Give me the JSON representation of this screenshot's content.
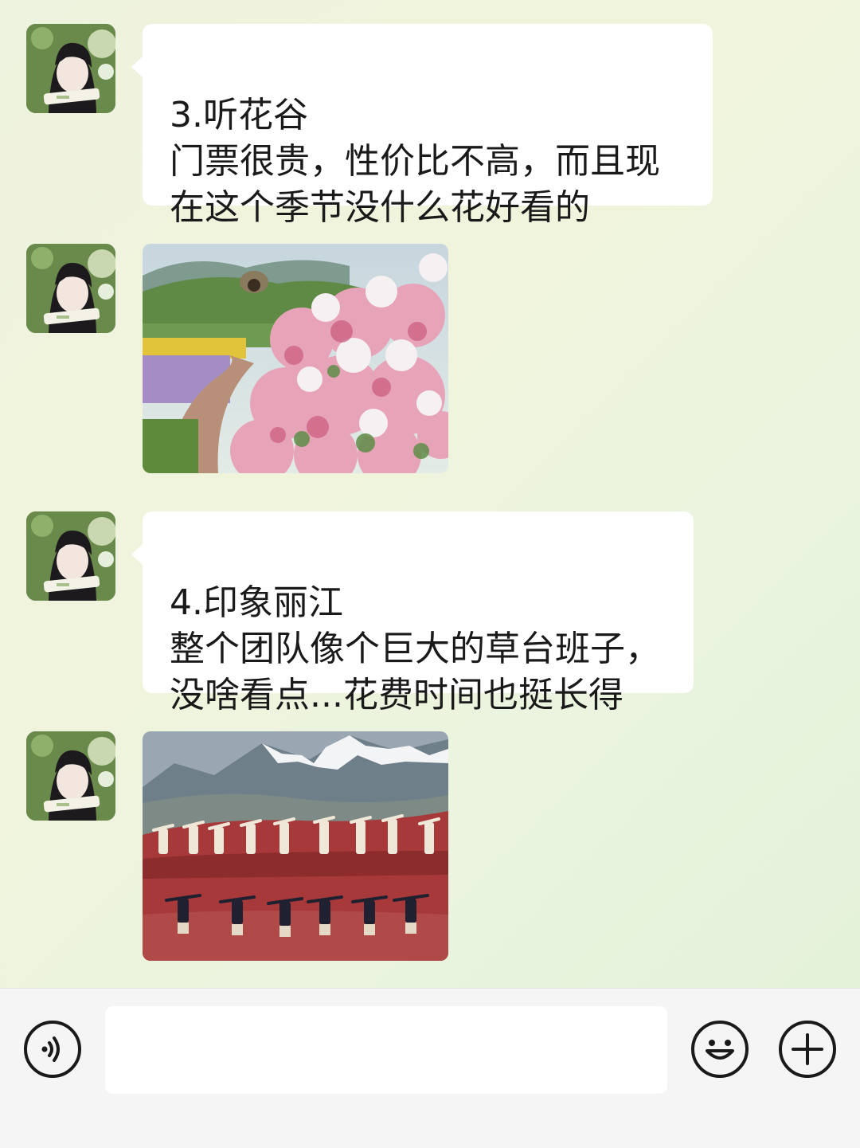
{
  "messages": [
    {
      "type": "text",
      "text": "3.听花谷\n门票很贵，性价比不高，而且现\n在这个季节没什么花好看的"
    },
    {
      "type": "image",
      "icon": "hydrangea-garden-photo"
    },
    {
      "type": "text",
      "text": "4.印象丽江\n整个团队像个巨大的草台班子，\n没啥看点...花费时间也挺长得"
    },
    {
      "type": "image",
      "icon": "impression-lijiang-performance-photo"
    }
  ],
  "input_bar": {
    "voice_icon": "voice-icon",
    "input_value": "",
    "emoji_icon": "emoji-icon",
    "plus_icon": "plus-icon"
  },
  "colors": {
    "background": "#eef3df",
    "bubble": "#ffffff",
    "text": "#1a1a1a",
    "input_bar": "#f5f5f5"
  }
}
